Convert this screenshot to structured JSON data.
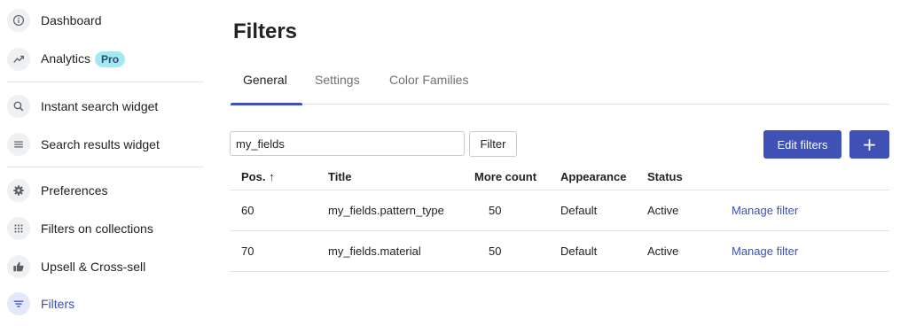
{
  "sidebar": {
    "items": [
      {
        "label": "Dashboard",
        "icon": "info-icon"
      },
      {
        "label": "Analytics",
        "icon": "trend-icon",
        "badge": "Pro"
      },
      {
        "label": "Instant search widget",
        "icon": "search-icon"
      },
      {
        "label": "Search results widget",
        "icon": "list-icon"
      },
      {
        "label": "Preferences",
        "icon": "gear-icon"
      },
      {
        "label": "Filters on collections",
        "icon": "grid-icon"
      },
      {
        "label": "Upsell & Cross-sell",
        "icon": "thumbs-up-icon"
      },
      {
        "label": "Filters",
        "icon": "filter-icon",
        "active": true
      }
    ]
  },
  "main": {
    "title": "Filters",
    "tabs": [
      {
        "label": "General",
        "active": true
      },
      {
        "label": "Settings"
      },
      {
        "label": "Color Families"
      }
    ],
    "search": {
      "value": "my_fields",
      "placeholder": ""
    },
    "filter_button": "Filter",
    "edit_button": "Edit filters",
    "add_button": "+",
    "table": {
      "headers": [
        "Pos. ↑",
        "Title",
        "More count",
        "Appearance",
        "Status"
      ],
      "rows": [
        {
          "pos": "60",
          "title": "my_fields.pattern_type",
          "more_count": "50",
          "appearance": "Default",
          "status": "Active",
          "action": "Manage filter"
        },
        {
          "pos": "70",
          "title": "my_fields.material",
          "more_count": "50",
          "appearance": "Default",
          "status": "Active",
          "action": "Manage filter"
        }
      ]
    }
  },
  "colors": {
    "accent": "#3f51b5",
    "link": "#3c50b8",
    "badge_bg": "#a4e8f2"
  }
}
